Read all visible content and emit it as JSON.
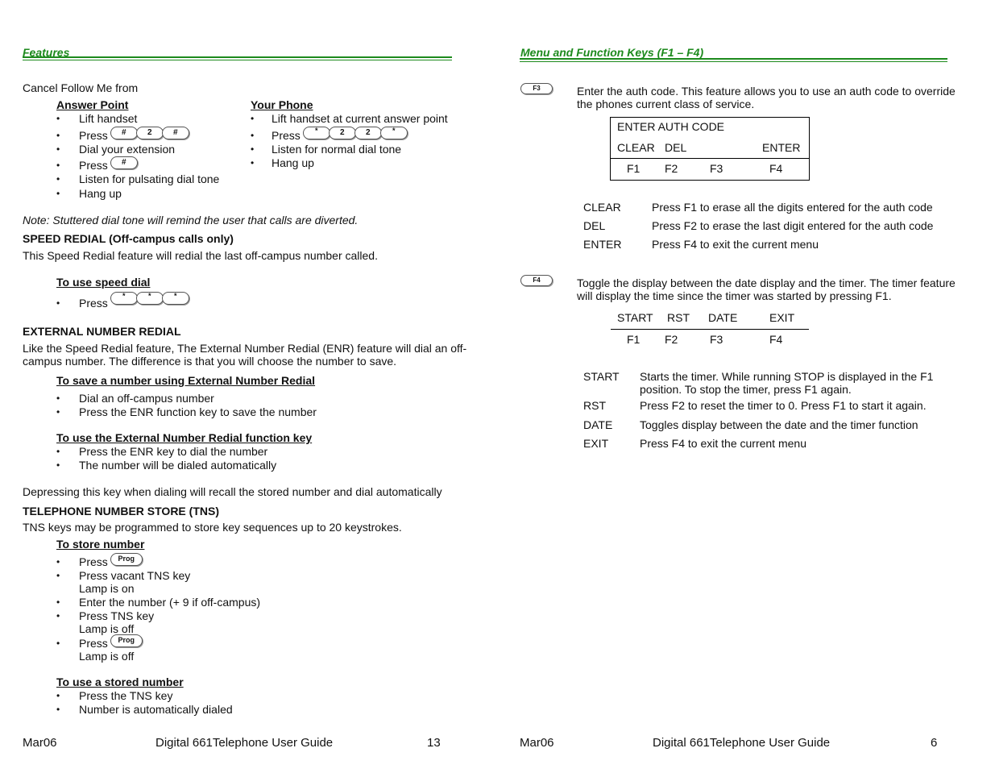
{
  "left_page": {
    "section_title": "Features",
    "intro": "Cancel Follow Me from",
    "answer_point": {
      "heading": "Answer Point",
      "items": [
        "Lift handset",
        "Press",
        "Dial your extension",
        "Press",
        "Listen for pulsating dial tone",
        "Hang up"
      ],
      "keys_1": [
        "#",
        "2",
        "#"
      ],
      "keys_2": [
        "#"
      ]
    },
    "your_phone": {
      "heading": "Your Phone",
      "items": [
        "Lift handset at current answer point",
        "Press",
        "Listen for normal dial tone",
        "Hang up"
      ],
      "keys": [
        "*",
        "2",
        "2",
        "*"
      ]
    },
    "note": "Note:  Stuttered dial tone will remind the user that calls are diverted.",
    "speed_redial": {
      "heading": "SPEED REDIAL (Off-campus calls only)",
      "desc": "This Speed Redial feature will redial the last off-campus number called.",
      "sub_heading": "To use speed dial",
      "item": "Press",
      "keys": [
        "*",
        "*",
        "*"
      ]
    },
    "enr": {
      "heading": "EXTERNAL NUMBER REDIAL",
      "desc_1": "Like the Speed Redial feature, The External Number Redial (ENR) feature will dial an off-",
      "desc_2": "campus number. The difference is that you will choose the number to save.",
      "save_heading": "To save a number using External Number Redial",
      "save_items": [
        "Dial an off-campus number",
        "Press the ENR function key to save the number"
      ],
      "use_heading": "To use the External Number Redial function key",
      "use_items": [
        "Press the ENR key to dial the number",
        "The number will be dialed automatically"
      ],
      "footer_note": "Depressing this key when dialing will recall the stored number and dial automatically"
    },
    "tns": {
      "heading": "TELEPHONE NUMBER STORE (TNS)",
      "desc": "TNS keys may be programmed to store key sequences up to 20 keystrokes.",
      "store_heading": "To store number",
      "store_items": [
        "Press",
        "Press vacant TNS key",
        "Enter the number (+ 9 if off-campus)",
        "Press TNS key",
        "Press"
      ],
      "store_subs": [
        "Lamp is on",
        "Lamp is off",
        "Lamp is off"
      ],
      "prog_key": "Prog",
      "use_heading": "To use a stored number",
      "use_items": [
        "Press the TNS key",
        "Number is automatically dialed"
      ]
    },
    "footer": {
      "date": "Mar06",
      "title": "Digital 661Telephone User Guide",
      "page": "13"
    }
  },
  "right_page": {
    "section_title": "Menu and Function Keys (F1 – F4)",
    "f3": {
      "key": "F3",
      "desc_1": "Enter the auth code. This feature allows you to use an auth code to override",
      "desc_2": "the phones current class of service.",
      "display_title": "ENTER AUTH CODE",
      "display_labels": [
        "CLEAR",
        "DEL",
        "",
        "ENTER"
      ],
      "fkeys": [
        "F1",
        "F2",
        "F3",
        "F4"
      ],
      "defs": [
        {
          "term": "CLEAR",
          "def": "Press F1 to erase all the digits entered for the auth code"
        },
        {
          "term": "DEL",
          "def": "Press F2 to erase the last digit entered for the auth code"
        },
        {
          "term": "ENTER",
          "def": "Press F4 to exit the current menu"
        }
      ]
    },
    "f4": {
      "key": "F4",
      "desc_1": "Toggle the display between the date display and the timer.  The timer feature",
      "desc_2": "will display the time since the timer was started by pressing F1.",
      "display_labels": [
        "START",
        "RST",
        "DATE",
        "EXIT"
      ],
      "fkeys": [
        "F1",
        "F2",
        "F3",
        "F4"
      ],
      "defs": [
        {
          "term": "START",
          "def": "Starts the timer.  While running STOP is displayed in the F1",
          "def2": "position. To stop the timer, press F1 again."
        },
        {
          "term": "RST",
          "def": "Press F2 to reset the timer to 0.  Press F1 to start it again."
        },
        {
          "term": "DATE",
          "def": "Toggles display between the date and the timer function"
        },
        {
          "term": "EXIT",
          "def": "Press F4 to exit the current menu"
        }
      ]
    },
    "footer": {
      "date": "Mar06",
      "title": "Digital 661Telephone User Guide",
      "page": "6"
    }
  }
}
